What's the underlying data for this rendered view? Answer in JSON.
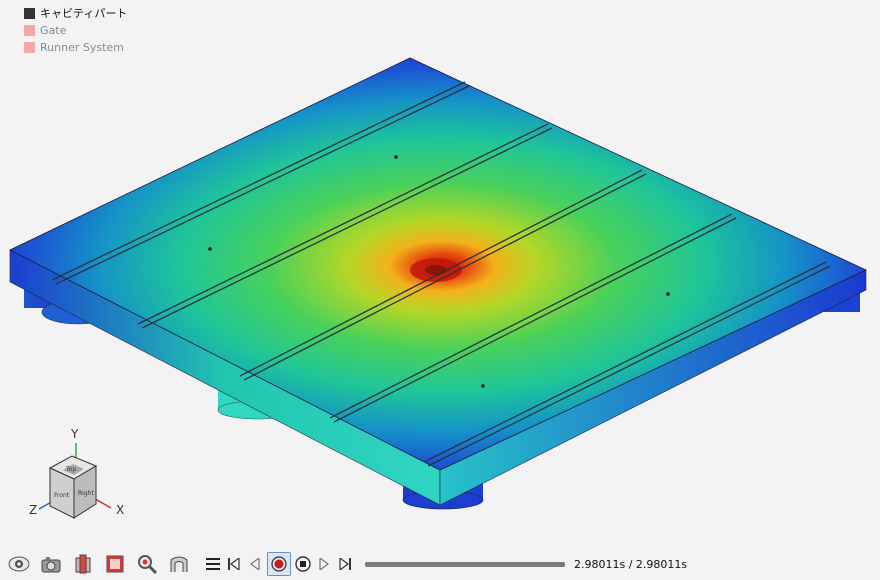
{
  "legend": {
    "items": [
      {
        "label": "キャビティパート",
        "color": "#333333",
        "text_color": "#111111"
      },
      {
        "label": "Gate",
        "color": "#f4a8a8",
        "text_color": "#8a8a8a"
      },
      {
        "label": "Runner System",
        "color": "#f4a8a8",
        "text_color": "#8a8a8a"
      }
    ]
  },
  "axes": {
    "y_label": "Y",
    "x_label": "X",
    "z_label": "Z",
    "cube_faces": {
      "top": "Top",
      "front": "Front",
      "right": "Right"
    }
  },
  "colors": {
    "contour_low": "#1335c9",
    "contour_mid": "#3ad86a",
    "contour_high": "#d21f0a",
    "axis_y": "#2fa84a",
    "axis_x": "#d03030",
    "axis_z": "#2f5fd0"
  },
  "toolbar": {
    "tools": [
      {
        "name": "view-eye-icon"
      },
      {
        "name": "camera-icon"
      },
      {
        "name": "section-view-icon"
      },
      {
        "name": "export-image-icon"
      },
      {
        "name": "zoom-inspect-icon"
      },
      {
        "name": "measure-icon"
      }
    ]
  },
  "player": {
    "time_current": "2.98011s",
    "separator": " / ",
    "time_total": "2.98011s",
    "progress": 1.0
  }
}
